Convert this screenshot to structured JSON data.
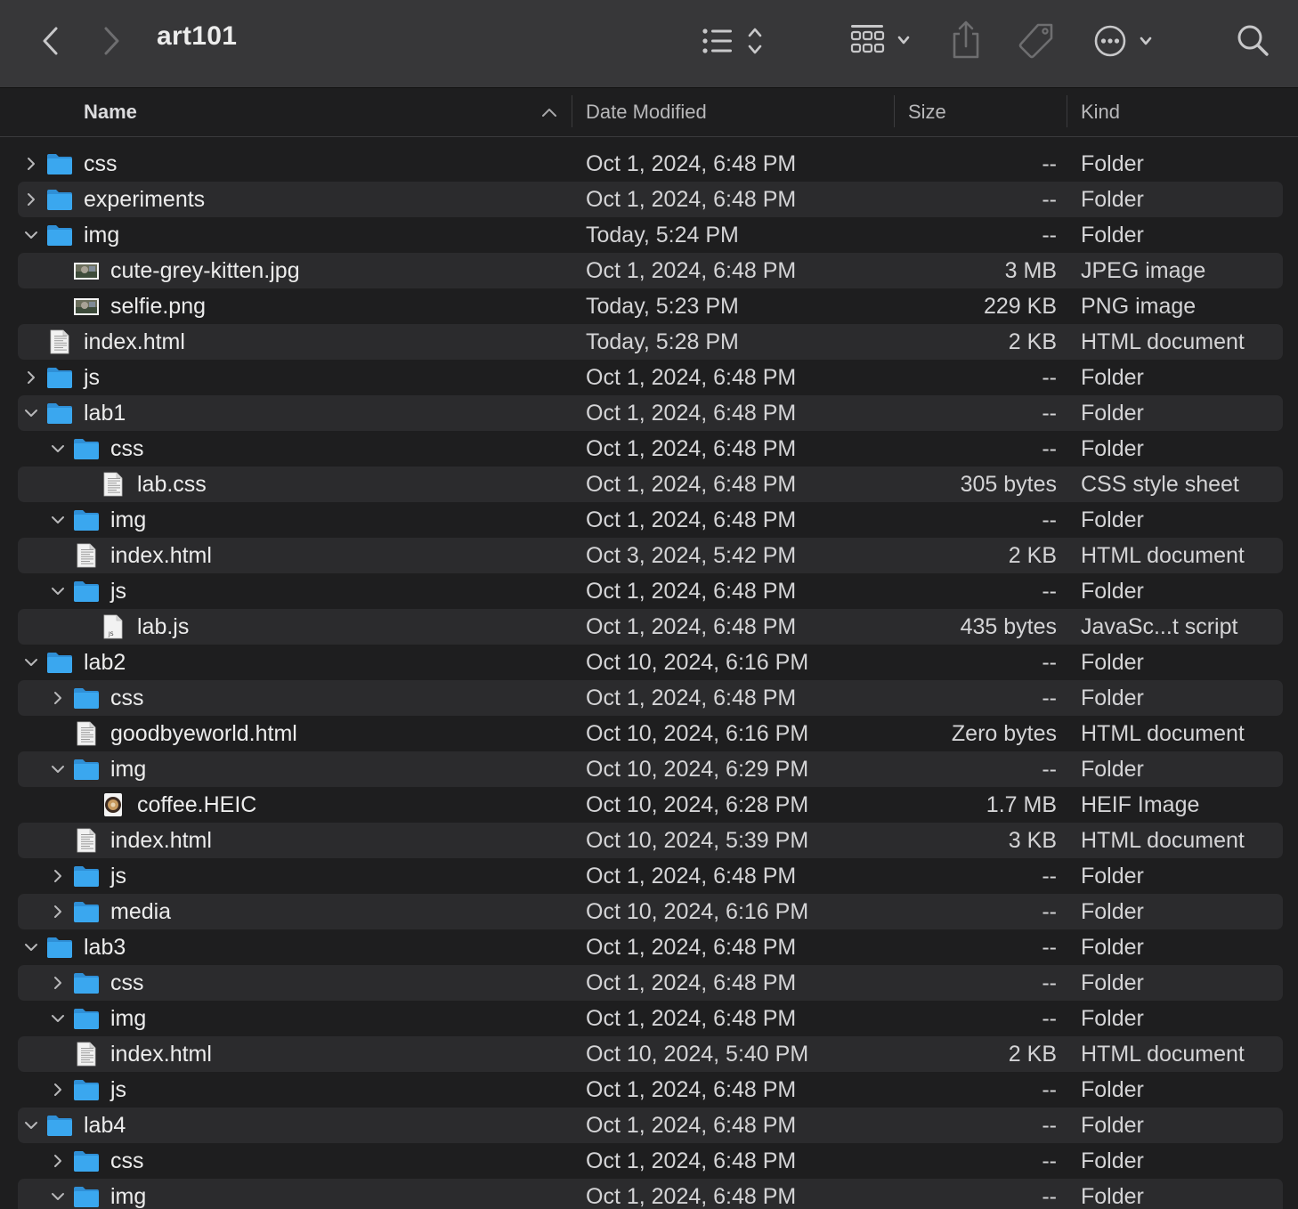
{
  "window": {
    "title": "art101"
  },
  "columns": {
    "name": "Name",
    "date": "Date Modified",
    "size": "Size",
    "kind": "Kind"
  },
  "rows": [
    {
      "name": "css",
      "date": "Oct 1, 2024, 6:48 PM",
      "size": "--",
      "kind": "Folder",
      "depth": 0,
      "type": "folder",
      "disclosure": "collapsed",
      "icon": "folder-icon"
    },
    {
      "name": "experiments",
      "date": "Oct 1, 2024, 6:48 PM",
      "size": "--",
      "kind": "Folder",
      "depth": 0,
      "type": "folder",
      "disclosure": "collapsed",
      "icon": "folder-icon"
    },
    {
      "name": "img",
      "date": "Today, 5:24 PM",
      "size": "--",
      "kind": "Folder",
      "depth": 0,
      "type": "folder",
      "disclosure": "expanded",
      "icon": "folder-icon"
    },
    {
      "name": "cute-grey-kitten.jpg",
      "date": "Oct 1, 2024, 6:48 PM",
      "size": "3 MB",
      "kind": "JPEG image",
      "depth": 1,
      "type": "image",
      "disclosure": "none",
      "icon": "image-thumbnail-icon"
    },
    {
      "name": "selfie.png",
      "date": "Today, 5:23 PM",
      "size": "229 KB",
      "kind": "PNG image",
      "depth": 1,
      "type": "image",
      "disclosure": "none",
      "icon": "image-thumbnail-icon"
    },
    {
      "name": "index.html",
      "date": "Today, 5:28 PM",
      "size": "2 KB",
      "kind": "HTML document",
      "depth": 0,
      "type": "doc",
      "disclosure": "none",
      "icon": "document-icon"
    },
    {
      "name": "js",
      "date": "Oct 1, 2024, 6:48 PM",
      "size": "--",
      "kind": "Folder",
      "depth": 0,
      "type": "folder",
      "disclosure": "collapsed",
      "icon": "folder-icon"
    },
    {
      "name": "lab1",
      "date": "Oct 1, 2024, 6:48 PM",
      "size": "--",
      "kind": "Folder",
      "depth": 0,
      "type": "folder",
      "disclosure": "expanded",
      "icon": "folder-icon"
    },
    {
      "name": "css",
      "date": "Oct 1, 2024, 6:48 PM",
      "size": "--",
      "kind": "Folder",
      "depth": 1,
      "type": "folder",
      "disclosure": "expanded",
      "icon": "folder-icon"
    },
    {
      "name": "lab.css",
      "date": "Oct 1, 2024, 6:48 PM",
      "size": "305 bytes",
      "kind": "CSS style sheet",
      "depth": 2,
      "type": "doc",
      "disclosure": "none",
      "icon": "document-icon"
    },
    {
      "name": "img",
      "date": "Oct 1, 2024, 6:48 PM",
      "size": "--",
      "kind": "Folder",
      "depth": 1,
      "type": "folder",
      "disclosure": "expanded",
      "icon": "folder-icon"
    },
    {
      "name": "index.html",
      "date": "Oct 3, 2024, 5:42 PM",
      "size": "2 KB",
      "kind": "HTML document",
      "depth": 1,
      "type": "doc",
      "disclosure": "none",
      "icon": "document-icon"
    },
    {
      "name": "js",
      "date": "Oct 1, 2024, 6:48 PM",
      "size": "--",
      "kind": "Folder",
      "depth": 1,
      "type": "folder",
      "disclosure": "expanded",
      "icon": "folder-icon"
    },
    {
      "name": "lab.js",
      "date": "Oct 1, 2024, 6:48 PM",
      "size": "435 bytes",
      "kind": "JavaSc...t script",
      "depth": 2,
      "type": "js",
      "disclosure": "none",
      "icon": "js-document-icon"
    },
    {
      "name": "lab2",
      "date": "Oct 10, 2024, 6:16 PM",
      "size": "--",
      "kind": "Folder",
      "depth": 0,
      "type": "folder",
      "disclosure": "expanded",
      "icon": "folder-icon"
    },
    {
      "name": "css",
      "date": "Oct 1, 2024, 6:48 PM",
      "size": "--",
      "kind": "Folder",
      "depth": 1,
      "type": "folder",
      "disclosure": "collapsed",
      "icon": "folder-icon"
    },
    {
      "name": "goodbyeworld.html",
      "date": "Oct 10, 2024, 6:16 PM",
      "size": "Zero bytes",
      "kind": "HTML document",
      "depth": 1,
      "type": "doc",
      "disclosure": "none",
      "icon": "document-icon"
    },
    {
      "name": "img",
      "date": "Oct 10, 2024, 6:29 PM",
      "size": "--",
      "kind": "Folder",
      "depth": 1,
      "type": "folder",
      "disclosure": "expanded",
      "icon": "folder-icon"
    },
    {
      "name": "coffee.HEIC",
      "date": "Oct 10, 2024, 6:28 PM",
      "size": "1.7 MB",
      "kind": "HEIF Image",
      "depth": 2,
      "type": "heic",
      "disclosure": "none",
      "icon": "image-thumbnail-icon"
    },
    {
      "name": "index.html",
      "date": "Oct 10, 2024, 5:39 PM",
      "size": "3 KB",
      "kind": "HTML document",
      "depth": 1,
      "type": "doc",
      "disclosure": "none",
      "icon": "document-icon"
    },
    {
      "name": "js",
      "date": "Oct 1, 2024, 6:48 PM",
      "size": "--",
      "kind": "Folder",
      "depth": 1,
      "type": "folder",
      "disclosure": "collapsed",
      "icon": "folder-icon"
    },
    {
      "name": "media",
      "date": "Oct 10, 2024, 6:16 PM",
      "size": "--",
      "kind": "Folder",
      "depth": 1,
      "type": "folder",
      "disclosure": "collapsed",
      "icon": "folder-icon"
    },
    {
      "name": "lab3",
      "date": "Oct 1, 2024, 6:48 PM",
      "size": "--",
      "kind": "Folder",
      "depth": 0,
      "type": "folder",
      "disclosure": "expanded",
      "icon": "folder-icon"
    },
    {
      "name": "css",
      "date": "Oct 1, 2024, 6:48 PM",
      "size": "--",
      "kind": "Folder",
      "depth": 1,
      "type": "folder",
      "disclosure": "collapsed",
      "icon": "folder-icon"
    },
    {
      "name": "img",
      "date": "Oct 1, 2024, 6:48 PM",
      "size": "--",
      "kind": "Folder",
      "depth": 1,
      "type": "folder",
      "disclosure": "expanded",
      "icon": "folder-icon"
    },
    {
      "name": "index.html",
      "date": "Oct 10, 2024, 5:40 PM",
      "size": "2 KB",
      "kind": "HTML document",
      "depth": 1,
      "type": "doc",
      "disclosure": "none",
      "icon": "document-icon"
    },
    {
      "name": "js",
      "date": "Oct 1, 2024, 6:48 PM",
      "size": "--",
      "kind": "Folder",
      "depth": 1,
      "type": "folder",
      "disclosure": "collapsed",
      "icon": "folder-icon"
    },
    {
      "name": "lab4",
      "date": "Oct 1, 2024, 6:48 PM",
      "size": "--",
      "kind": "Folder",
      "depth": 0,
      "type": "folder",
      "disclosure": "expanded",
      "icon": "folder-icon"
    },
    {
      "name": "css",
      "date": "Oct 1, 2024, 6:48 PM",
      "size": "--",
      "kind": "Folder",
      "depth": 1,
      "type": "folder",
      "disclosure": "collapsed",
      "icon": "folder-icon"
    },
    {
      "name": "img",
      "date": "Oct 1, 2024, 6:48 PM",
      "size": "--",
      "kind": "Folder",
      "depth": 1,
      "type": "folder",
      "disclosure": "expanded",
      "icon": "folder-icon"
    }
  ],
  "colors": {
    "toolbar_bg": "#373739",
    "list_bg": "#1e1e1f",
    "row_alt_bg": "#2b2b2d",
    "folder_blue": "#3aa7ef",
    "text": "#ececec"
  }
}
